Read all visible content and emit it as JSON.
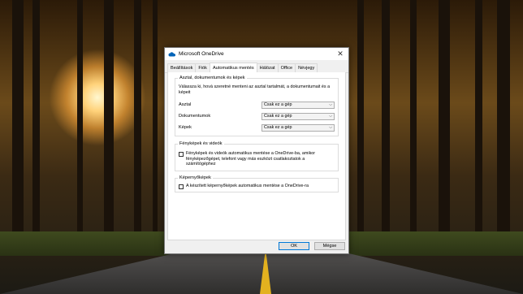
{
  "window": {
    "title": "Microsoft OneDrive",
    "close_symbol": "✕"
  },
  "tabs": [
    {
      "label": "Beállítások"
    },
    {
      "label": "Fiók"
    },
    {
      "label": "Automatikus mentés",
      "active": true
    },
    {
      "label": "Hálózat"
    },
    {
      "label": "Office"
    },
    {
      "label": "Névjegy"
    }
  ],
  "folders_group": {
    "title": "Asztal, dokumentumok és képek",
    "description": "Válassza ki, hová szeretné menteni az asztal tartalmát, a dokumentumait és a képeit",
    "rows": [
      {
        "label": "Asztal",
        "value": "Csak ez a gép"
      },
      {
        "label": "Dokumentumok",
        "value": "Csak ez a gép"
      },
      {
        "label": "Képek",
        "value": "Csak ez a gép"
      }
    ]
  },
  "photos_group": {
    "title": "Fényképek és videók",
    "checkbox_label": "Fényképek és videók automatikus mentése a OneDrive-ba, amikor fényképezőgépet, telefont vagy más eszközt csatlakoztatok a számítógéphez",
    "checked": false
  },
  "screenshots_group": {
    "title": "Képernyőképek",
    "checkbox_label": "A készített képernyőképek automatikus mentése a OneDrive-ra",
    "checked": false
  },
  "buttons": {
    "ok": "OK",
    "cancel": "Mégse"
  },
  "colors": {
    "accent": "#0078d7",
    "window_bg": "#f0f0f0"
  }
}
